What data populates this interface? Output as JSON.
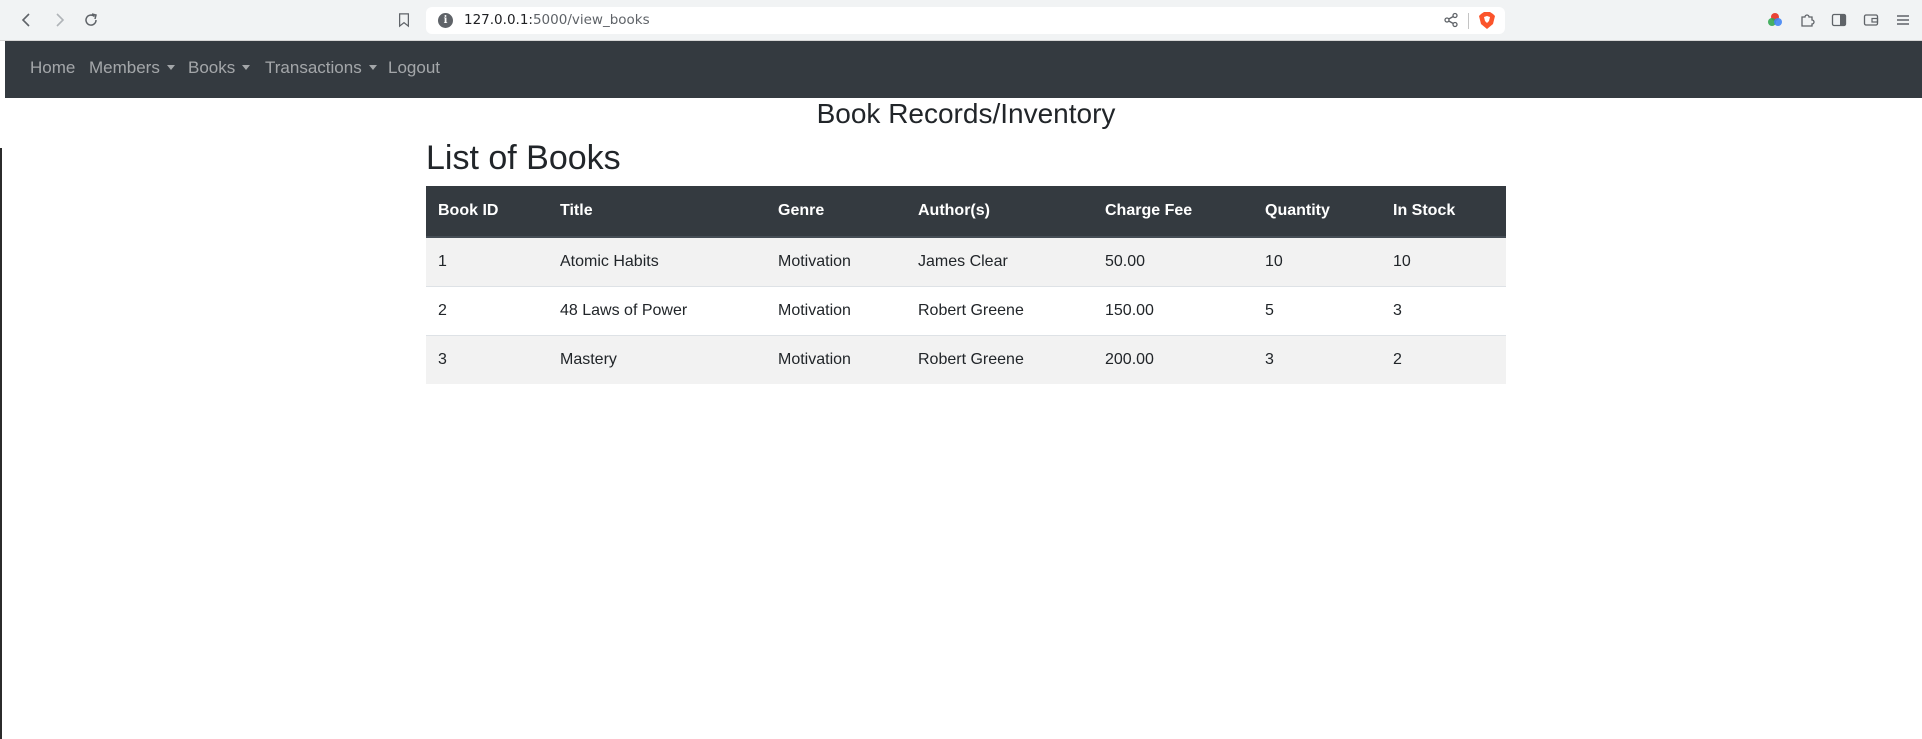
{
  "browser": {
    "url_host": "127.0.0.1:",
    "url_path": "5000/view_books"
  },
  "navbar": {
    "items": [
      {
        "label": "Home"
      },
      {
        "label": "Members"
      },
      {
        "label": "Books"
      },
      {
        "label": "Transactions"
      },
      {
        "label": "Logout"
      }
    ]
  },
  "page": {
    "heading": "Book Records/Inventory",
    "list_title": "List of Books"
  },
  "table": {
    "headers": [
      "Book ID",
      "Title",
      "Genre",
      "Author(s)",
      "Charge Fee",
      "Quantity",
      "In Stock"
    ],
    "rows": [
      [
        "1",
        "Atomic Habits",
        "Motivation",
        "James Clear",
        "50.00",
        "10",
        "10"
      ],
      [
        "2",
        "48 Laws of Power",
        "Motivation",
        "Robert Greene",
        "150.00",
        "5",
        "3"
      ],
      [
        "3",
        "Mastery",
        "Motivation",
        "Robert Greene",
        "200.00",
        "3",
        "2"
      ]
    ]
  },
  "colors": {
    "navbar_bg": "#343a40",
    "table_header_bg": "#343a40",
    "stripe_bg": "#f2f2f2",
    "brave_orange": "#fb542b"
  },
  "icons": {
    "back": "arrow-left-icon",
    "forward": "arrow-right-icon",
    "reload": "reload-icon",
    "bookmark": "bookmark-icon",
    "site_info": "info-icon",
    "share": "share-icon",
    "brave": "brave-shield-icon",
    "extensions": "puzzle-icon",
    "sidebar": "sidebar-icon",
    "wallet": "wallet-icon",
    "menu": "hamburger-menu-icon"
  }
}
